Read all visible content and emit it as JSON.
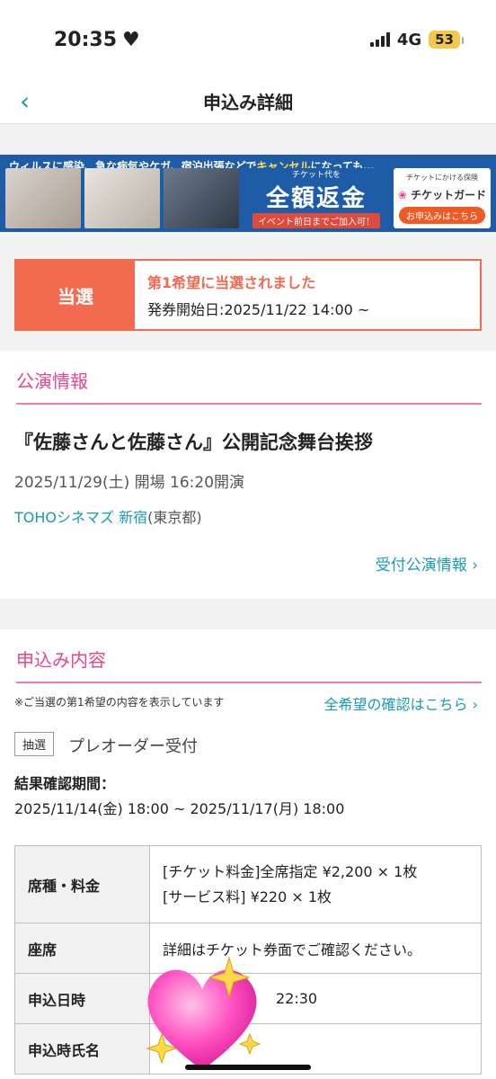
{
  "status": {
    "time": "20:35",
    "network": "4G",
    "battery": "53"
  },
  "nav": {
    "title": "申込み詳細"
  },
  "ad": {
    "top_text_1": "ウィルスに感染、急な病気やケガ、宿泊出張などで",
    "top_text_2": "キャンセル",
    "top_text_3": "になっても…",
    "refund_small": "チケット代を",
    "refund_big": "全額返金",
    "refund_sub": "イベント前日までご加入可！",
    "guard_small": "チケットにかける保険",
    "guard_name": "チケットガード",
    "guard_button": "お申込みはこちら"
  },
  "result": {
    "badge": "当選",
    "line1": "第1希望に当選されました",
    "line2": "発券開始日:2025/11/22 14:00 ~"
  },
  "performance": {
    "section_title": "公演情報",
    "event_title": "『佐藤さんと佐藤さん』公開記念舞台挨拶",
    "date": "2025/11/29(土) 開場 16:20開演",
    "venue_link": "TOHOシネマズ 新宿",
    "venue_area": "(東京都)",
    "info_link": "受付公演情報"
  },
  "application": {
    "section_title": "申込み内容",
    "note": "※ご当選の第1希望の内容を表示しています",
    "all_link": "全希望の確認はこちら",
    "tag": "抽選",
    "type": "プレオーダー受付",
    "period_label": "結果確認期間：",
    "period_value": "2025/11/14(金) 18:00 ~ 2025/11/17(月) 18:00",
    "table": {
      "seat_price_label": "席種・料金",
      "seat_price_line1": "[チケット料金]全席指定 ¥2,200 × 1枚",
      "seat_price_line2": "[サービス料] ¥220 × 1枚",
      "seat_label": "座席",
      "seat_value": "詳細はチケット券面でご確認ください。",
      "applied_label": "申込日時",
      "applied_value": "22:30",
      "name_label": "申込時氏名",
      "name_value": ""
    }
  },
  "colors": {
    "accent": "#1a9bb0",
    "pink": "#e8458b",
    "result": "#f26a4f"
  }
}
